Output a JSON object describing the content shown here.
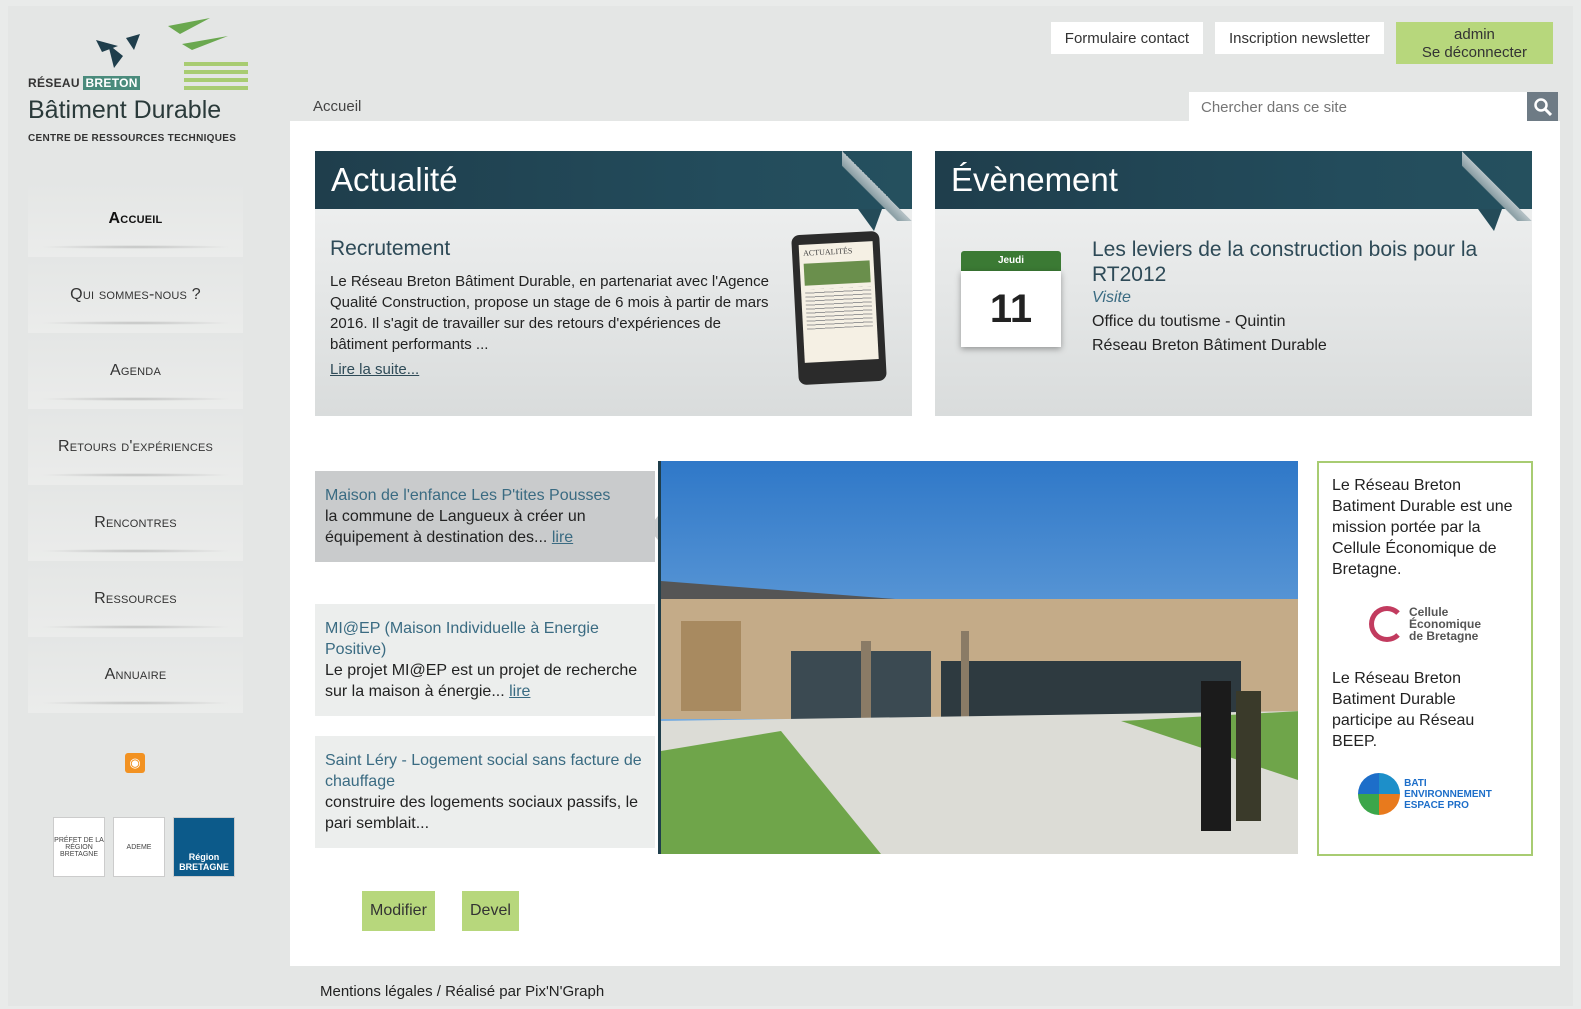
{
  "logo": {
    "line1_a": "RÉSEAU",
    "line1_b": "BRETON",
    "line2": "Bâtiment Durable",
    "line3": "CENTRE DE RESSOURCES TECHNIQUES"
  },
  "toplinks": {
    "contact": "Formulaire contact",
    "newsletter": "Inscription newsletter",
    "admin_user": "admin",
    "logout": "Se déconnecter"
  },
  "breadcrumb": "Accueil",
  "search": {
    "placeholder": "Chercher dans ce site"
  },
  "sidebar": {
    "items": [
      {
        "label": "Accueil"
      },
      {
        "label": "Qui sommes-nous ?"
      },
      {
        "label": "Agenda"
      },
      {
        "label": "Retours d'expériences"
      },
      {
        "label": "Rencontres"
      },
      {
        "label": "Ressources"
      },
      {
        "label": "Annuaire"
      }
    ],
    "rss_icon": "rss-icon",
    "partners": [
      {
        "label": "PRÉFET DE LA RÉGION BRETAGNE"
      },
      {
        "label": "ADEME"
      },
      {
        "label": "Région BRETAGNE"
      }
    ]
  },
  "news": {
    "header": "Actualité",
    "title": "Recrutement",
    "text": "Le Réseau Breton Bâtiment Durable, en partenariat avec l'Agence Qualité Construction, propose un stage de 6 mois à partir de mars 2016. Il s'agit de travailler sur des retours d'expériences de bâtiment performants ...",
    "link": "Lire la suite...",
    "tablet_label": "ACTUALITÉS"
  },
  "event": {
    "header": "Évènement",
    "cal_dayname": "Jeudi",
    "cal_day": "11",
    "title": "Les leviers de la construction bois pour la RT2012",
    "type": "Visite",
    "place": "Office du toutisme - Quintin",
    "org": "Réseau Breton Bâtiment Durable"
  },
  "slides": [
    {
      "title": "Maison de l'enfance Les P'tites Pousses",
      "text": "la commune de Langueux à créer un équipement à destination des...",
      "link": "lire"
    },
    {
      "title": "MI@EP (Maison Individuelle à Energie Positive)",
      "text": "Le projet MI@EP est un projet de recherche sur la maison à énergie...",
      "link": "lire"
    },
    {
      "title": "Saint Léry - Logement social sans facture de chauffage",
      "text": "construire des logements sociaux passifs, le pari semblait...",
      "link": ""
    }
  ],
  "infobox": {
    "text1": "Le Réseau Breton Batiment Durable est une mission portée par la Cellule Économique de Bretagne.",
    "cell_logo_text_1": "Cellule",
    "cell_logo_text_2": "Économique",
    "cell_logo_text_3": "de Bretagne",
    "text2": "Le Réseau Breton Batiment Durable participe au Réseau BEEP.",
    "beep_logo_1": "BATI",
    "beep_logo_2": "ENVIRONNEMENT",
    "beep_logo_3": "ESPACE PRO"
  },
  "buttons": {
    "modify": "Modifier",
    "devel": "Devel"
  },
  "footer": "Mentions légales / Réalisé par Pix'N'Graph"
}
